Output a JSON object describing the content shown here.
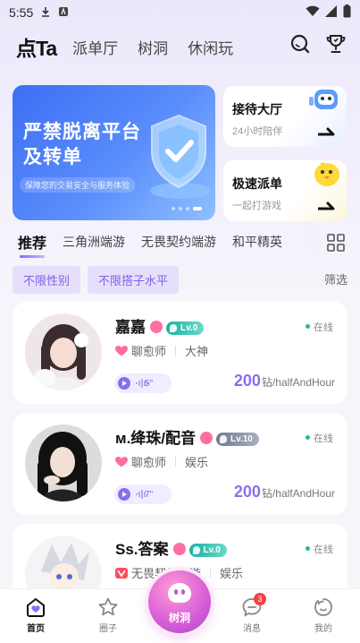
{
  "status": {
    "time": "5:55"
  },
  "topnav": {
    "brand": "点Ta",
    "tabs": [
      "派单厅",
      "树洞",
      "休闲玩"
    ]
  },
  "banner": {
    "line1": "严禁脱离平台",
    "line2": "及转单",
    "sub": "保障您的交易安全与服务体验"
  },
  "cards": [
    {
      "title": "接待大厅",
      "sub": "24小时陪伴"
    },
    {
      "title": "极速派单",
      "sub": "一起打游戏"
    }
  ],
  "tabs": [
    "推荐",
    "三角洲端游",
    "无畏契约端游",
    "和平精英"
  ],
  "filters": [
    "不限性别",
    "不限搭子水平"
  ],
  "filter_label": "筛选",
  "online_text": "在线",
  "price_unit": "钻/halfAndHour",
  "list": [
    {
      "name": "嘉嘉",
      "level": "Lv.0",
      "role": "聊愈师",
      "tag": "大神",
      "duration": "5\"",
      "price": "200"
    },
    {
      "name": "м.绛珠/配音",
      "level": "Lv.10",
      "role": "聊愈师",
      "tag": "娱乐",
      "duration": "7\"",
      "price": "200"
    },
    {
      "name": "Ss.答案",
      "level": "Lv.0",
      "role": "无畏契约端游",
      "tag": "娱乐",
      "duration": "",
      "price": ""
    }
  ],
  "bottomnav": {
    "home": "首页",
    "circle": "圈子",
    "center": "树洞",
    "messages": "消息",
    "messages_badge": "3",
    "mine": "我的"
  }
}
